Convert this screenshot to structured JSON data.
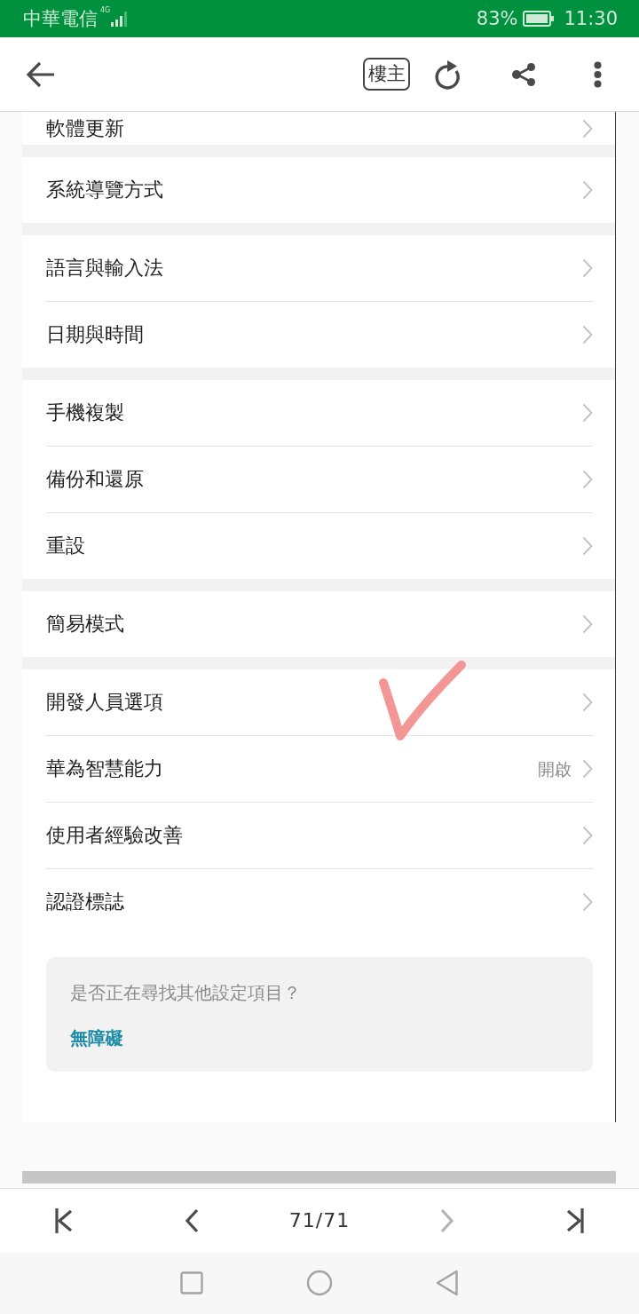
{
  "status_bar": {
    "carrier": "中華電信",
    "network": "4G",
    "battery": "83%",
    "time": "11:30"
  },
  "toolbar": {
    "badge": "樓主"
  },
  "screenshot": {
    "sections": [
      {
        "items": [
          {
            "label": "軟體更新"
          }
        ]
      },
      {
        "items": [
          {
            "label": "系統導覽方式"
          }
        ]
      },
      {
        "items": [
          {
            "label": "語言與輸入法"
          },
          {
            "label": "日期與時間"
          }
        ]
      },
      {
        "items": [
          {
            "label": "手機複製"
          },
          {
            "label": "備份和還原"
          },
          {
            "label": "重設"
          }
        ]
      },
      {
        "items": [
          {
            "label": "簡易模式"
          }
        ]
      },
      {
        "items": [
          {
            "label": "開發人員選項"
          },
          {
            "label": "華為智慧能力",
            "value": "開啟"
          },
          {
            "label": "使用者經驗改善"
          },
          {
            "label": "認證標誌"
          }
        ]
      }
    ],
    "help_card": {
      "question": "是否正在尋找其他設定項目？",
      "link": "無障礙"
    }
  },
  "pager": {
    "items": [
      {
        "kind": "first",
        "disabled": false
      },
      {
        "kind": "prev",
        "disabled": false
      },
      {
        "kind": "page",
        "text": "71/71"
      },
      {
        "kind": "next",
        "disabled": true
      },
      {
        "kind": "last",
        "disabled": false
      }
    ]
  }
}
